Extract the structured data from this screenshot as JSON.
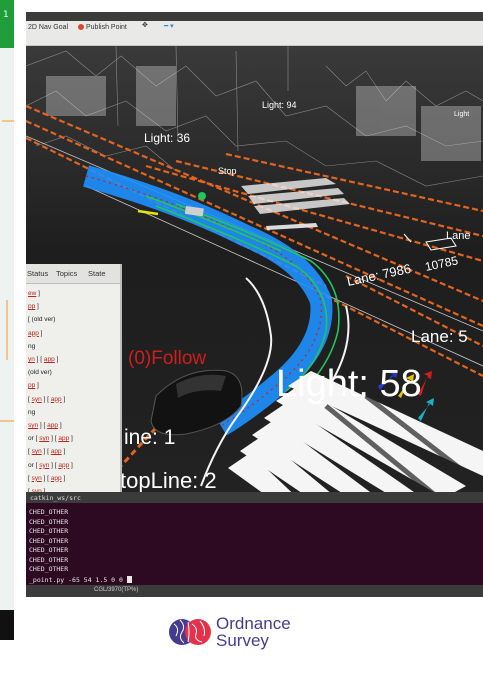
{
  "toolbar": {
    "nav_goal_label": "2D Nav Goal",
    "publish_point_label": "Publish Point"
  },
  "viewport_labels": {
    "light_36": "Light: 36",
    "light_94": "Light: 94",
    "light_cut": "Light",
    "stop_small": "Stop",
    "lane_small": "Lane",
    "lane_7986": "Lane: 7986",
    "lane_10785": "10785",
    "lane_big": "Lane: 5",
    "follow": "(0)Follow",
    "light_58": "Light:  58",
    "line_1": "ine:  1",
    "stopline_2": "topLine:  2"
  },
  "panel": {
    "tabs": [
      "Status",
      "Topics",
      "State"
    ],
    "lines": [
      {
        "plain": "",
        "links": [
          "ew"
        ],
        "suffix": " ]"
      },
      {
        "plain": "",
        "links": [
          "pp"
        ],
        "suffix": " ]"
      },
      {
        "plain": "[ (old ver)",
        "links": [],
        "suffix": ""
      },
      {
        "plain": "",
        "links": [
          "app"
        ],
        "suffix": " ]"
      },
      {
        "plain": "ng",
        "links": [],
        "suffix": ""
      },
      {
        "plain": "",
        "links": [
          "yn",
          "app"
        ],
        "suffix": " ]"
      },
      {
        "plain": "(old ver)",
        "links": [],
        "suffix": ""
      },
      {
        "plain": "",
        "links": [
          "pp"
        ],
        "suffix": " ]"
      },
      {
        "plain": "[ ",
        "links": [
          "syn",
          "app"
        ],
        "suffix": " ]"
      },
      {
        "plain": "ng",
        "links": [],
        "suffix": ""
      },
      {
        "plain": "",
        "links": [
          "syn",
          "app"
        ],
        "suffix": " ]"
      },
      {
        "plain": "or [ ",
        "links": [
          "syn",
          "app"
        ],
        "suffix": " ]"
      },
      {
        "plain": "[ ",
        "links": [
          "syn",
          "app"
        ],
        "suffix": " ]"
      },
      {
        "plain": "or [ ",
        "links": [
          "syn",
          "app"
        ],
        "suffix": " ]"
      },
      {
        "plain": "[ ",
        "links": [
          "syn",
          "app"
        ],
        "suffix": " ]"
      },
      {
        "plain": "[ ",
        "links": [
          "syn"
        ],
        "suffix": " ]"
      }
    ]
  },
  "terminal": {
    "title": "catkin_ws/src",
    "lines": [
      "CHED_OTHER",
      "CHED_OTHER",
      "CHED_OTHER",
      "CHED_OTHER",
      "CHED_OTHER",
      "CHED_OTHER",
      "CHED_OTHER"
    ],
    "command": "_point.py -65 54 1.5 0 0"
  },
  "status": "CGL/3970(TP%)",
  "logo": {
    "line1": "Ordnance",
    "line2": "Survey"
  },
  "colors": {
    "map_green": "#1f9e3a",
    "terminal_bg": "#2d0a22",
    "os_purple": "#453c90",
    "os_red": "#e4324d",
    "path_blue": "#1e90ff",
    "lane_orange": "#e2641f",
    "text_red": "#d11d1d"
  }
}
